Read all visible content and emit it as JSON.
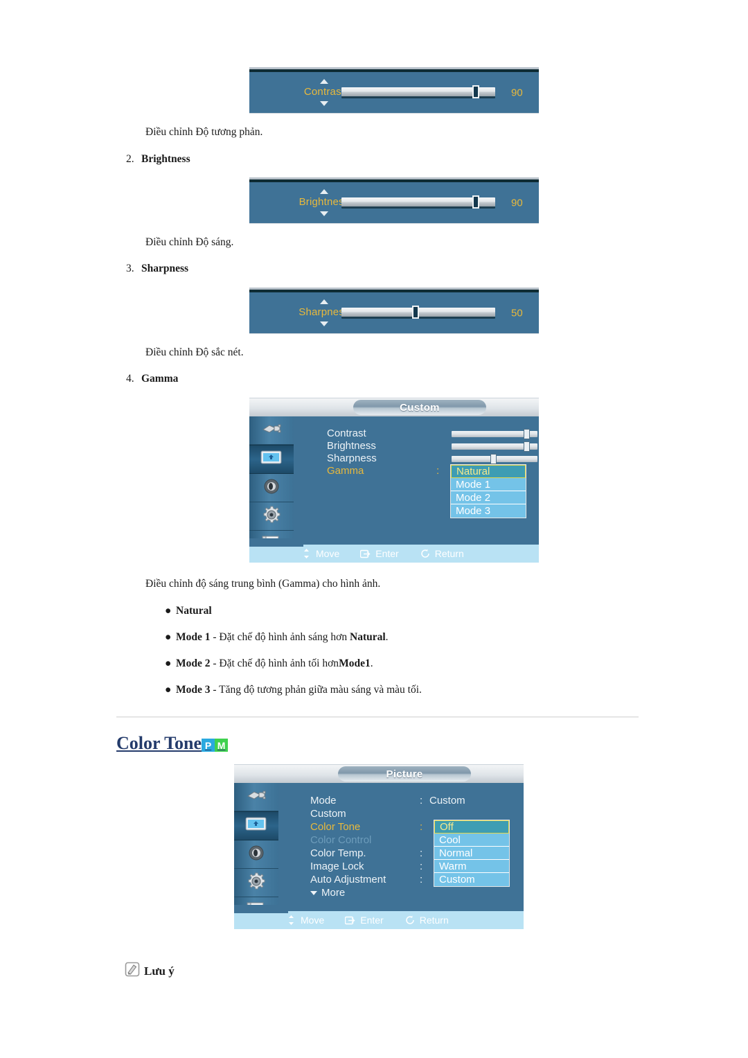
{
  "page": {
    "background": "#ffffff",
    "osd_panel_color": "#3f7296",
    "osd_accent_yellow": "#e8b93c"
  },
  "sliders": [
    {
      "name": "contrast",
      "label": "Contrast",
      "value": "90",
      "fill_percent": 90,
      "up_arrow": "triangle-up-icon",
      "down_arrow": "triangle-down-icon"
    },
    {
      "name": "brightness",
      "label": "Brightness",
      "value": "90",
      "fill_percent": 90,
      "up_arrow": "triangle-up-icon",
      "down_arrow": "triangle-down-icon"
    },
    {
      "name": "sharpness",
      "label": "Sharpness",
      "value": "50",
      "fill_percent": 50,
      "up_arrow": "triangle-up-icon",
      "down_arrow": "triangle-down-icon"
    }
  ],
  "captions": {
    "contrast": "Điều chỉnh Độ tương phản.",
    "brightness": "Điều chỉnh Độ sáng.",
    "sharpness": "Điều chỉnh Độ sắc nét.",
    "gamma": "Điều chỉnh độ sáng trung bình (Gamma) cho hình ảnh."
  },
  "list_items": [
    {
      "number": "2.",
      "label": "Brightness"
    },
    {
      "number": "3.",
      "label": "Sharpness"
    },
    {
      "number": "4.",
      "label": "Gamma"
    }
  ],
  "osd_custom": {
    "title": "Custom",
    "sidebar_icons": [
      "input-source-icon",
      "picture-monitor-icon",
      "sound-speaker-icon",
      "setup-gear-icon",
      "multi-control-icon"
    ],
    "active_sidebar_index": 1,
    "rows": [
      {
        "label": "Contrast",
        "value": "90",
        "fill_percent": 90,
        "type": "slider"
      },
      {
        "label": "Brightness",
        "value": "90",
        "fill_percent": 90,
        "type": "slider"
      },
      {
        "label": "Sharpness",
        "value": "50",
        "fill_percent": 50,
        "type": "slider"
      },
      {
        "label": "Gamma",
        "value": "",
        "type": "dropdown",
        "highlight": true,
        "colon": ":"
      }
    ],
    "dropdown_options": [
      {
        "label": "Natural",
        "selected": true
      },
      {
        "label": "Mode 1",
        "selected": false
      },
      {
        "label": "Mode 2",
        "selected": false
      },
      {
        "label": "Mode 3",
        "selected": false
      }
    ],
    "footer": [
      {
        "icon": "move-updown-icon",
        "label": "Move"
      },
      {
        "icon": "enter-icon",
        "label": "Enter"
      },
      {
        "icon": "return-arrow-icon",
        "label": "Return"
      }
    ]
  },
  "gamma_bullets": [
    {
      "bold": "Natural",
      "rest": ""
    },
    {
      "bold": "Mode 1",
      "rest": " - Đặt chế độ hình ảnh sáng hơn ",
      "bold2": "Natural",
      "tail": "."
    },
    {
      "bold": "Mode 2",
      "rest": " - Đặt chế độ hình ảnh tối hơn",
      "bold2": "Mode1",
      "tail": "."
    },
    {
      "bold": "Mode 3",
      "rest": " - Tăng độ tương phản giữa màu sáng và màu tối.",
      "bold2": "",
      "tail": ""
    }
  ],
  "color_tone_section": {
    "heading": "Color Tone",
    "badges": [
      {
        "letter": "P",
        "color": "#2aa9e0"
      },
      {
        "letter": "M",
        "color": "#3fd14f"
      }
    ]
  },
  "osd_picture": {
    "title": "Picture",
    "sidebar_icons": [
      "input-source-icon",
      "picture-monitor-icon",
      "sound-speaker-icon",
      "setup-gear-icon",
      "multi-control-icon"
    ],
    "active_sidebar_index": 1,
    "rows": [
      {
        "label": "Mode",
        "colon": ":",
        "value": "Custom",
        "state": "normal"
      },
      {
        "label": "Custom",
        "colon": "",
        "value": "",
        "state": "normal"
      },
      {
        "label": "Color Tone",
        "colon": ":",
        "value": "",
        "state": "highlight"
      },
      {
        "label": "Color Control",
        "colon": "",
        "value": "",
        "state": "disabled"
      },
      {
        "label": "Color Temp.",
        "colon": ":",
        "value": "",
        "state": "normal"
      },
      {
        "label": "Image Lock",
        "colon": ":",
        "value": "",
        "state": "normal"
      },
      {
        "label": "Auto Adjustment",
        "colon": ":",
        "value": "",
        "state": "normal"
      },
      {
        "label": "More",
        "colon": "",
        "value": "",
        "state": "more",
        "icon": "chevron-down-icon"
      }
    ],
    "dropdown_options": [
      {
        "label": "Off",
        "selected": true
      },
      {
        "label": "Cool",
        "selected": false
      },
      {
        "label": "Normal",
        "selected": false
      },
      {
        "label": "Warm",
        "selected": false
      },
      {
        "label": "Custom",
        "selected": false
      }
    ],
    "footer": [
      {
        "icon": "move-updown-icon",
        "label": "Move"
      },
      {
        "icon": "enter-icon",
        "label": "Enter"
      },
      {
        "icon": "return-arrow-icon",
        "label": "Return"
      }
    ]
  },
  "note": {
    "icon": "note-pencil-icon",
    "label": "Lưu ý"
  }
}
